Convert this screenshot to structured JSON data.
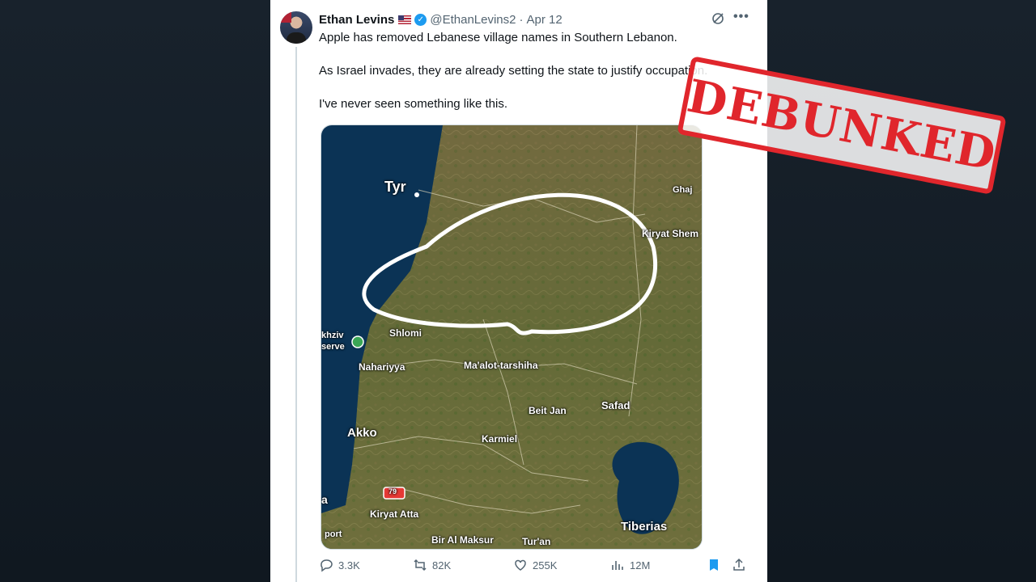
{
  "tweet": {
    "author_name": "Ethan Levins",
    "handle": "@EthanLevins2",
    "separator": "·",
    "date": "Apr 12",
    "more_label": "•••",
    "text": [
      "Apple has removed Lebanese village names in Southern Lebanon.",
      "As Israel invades, they are already setting the state to justify occupation.",
      "I've never seen something like this."
    ]
  },
  "map": {
    "labels": {
      "tyr": "Tyr",
      "ghajar": "Ghaj",
      "kiryat_shemona": "Kiryat Shem",
      "shlomi": "Shlomi",
      "achziv": "khziv",
      "reserve": "serve",
      "nahariyya": "Nahariyya",
      "maalot": "Ma'alot-tarshiha",
      "safad": "Safad",
      "beit_jan": "Beit Jan",
      "akko": "Akko",
      "karmiel": "Karmiel",
      "kiryat_ata": "Kiryat Atta",
      "bir_al_maksur": "Bir Al Maksur",
      "turan": "Tur'an",
      "tiberias": "Tiberias",
      "haifa_partial": "a",
      "airport": "port",
      "road_number": "79"
    }
  },
  "actions": {
    "replies": "3.3K",
    "reposts": "82K",
    "likes": "255K",
    "views": "12M"
  },
  "stamp": {
    "text": "DEBUNKED",
    "color": "#e0262c"
  }
}
